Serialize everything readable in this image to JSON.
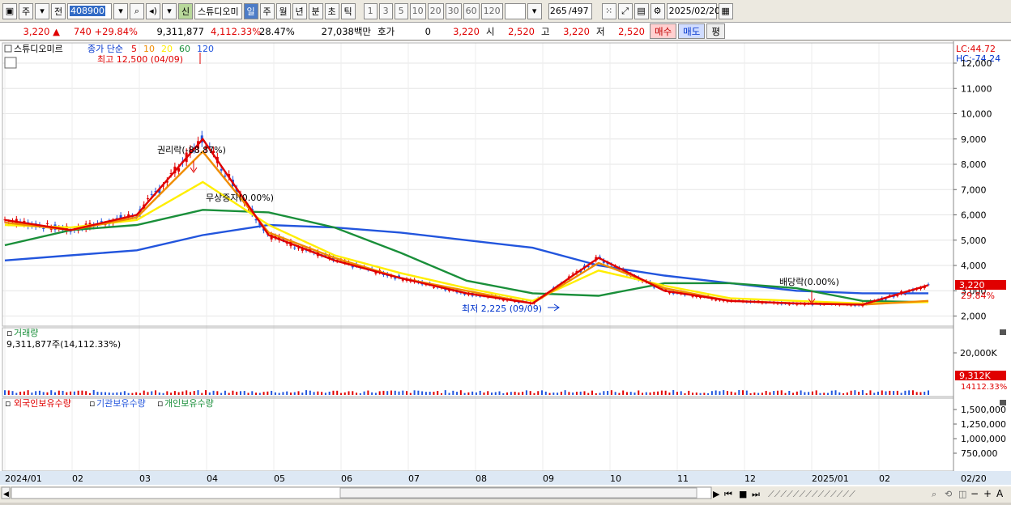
{
  "toolbar": {
    "market": "주",
    "prefix": "전",
    "code": "408900",
    "sin": "신",
    "stock_name": "스튜디오미",
    "periods": [
      "일",
      "주",
      "월",
      "년",
      "분",
      "초",
      "틱"
    ],
    "selected_period": "일",
    "intervals": [
      "1",
      "3",
      "5",
      "10",
      "20",
      "30",
      "60",
      "120"
    ],
    "count": "265",
    "total": "/497",
    "date": "2025/02/20"
  },
  "quote": {
    "price": "3,220",
    "change": "740",
    "change_pct": "+29.84%",
    "volume": "9,311,877",
    "volume_pct": "4,112.33%",
    "turnover": "28.47%",
    "amount": "27,038백만",
    "hoga_label": "호가",
    "hoga_value": "0",
    "hoga_price": "3,220",
    "open_label": "시",
    "open": "2,520",
    "high_label": "고",
    "high": "3,220",
    "low_label": "저",
    "low": "2,520",
    "buy": "매수",
    "sell": "매도",
    "eval": "평"
  },
  "price_panel": {
    "stock_label": "스튜디오미르",
    "ma_title": "종가 단순",
    "ma_periods": [
      "5",
      "10",
      "20",
      "60",
      "120"
    ],
    "ma_colors": [
      "#e00000",
      "#f08c00",
      "#ffee00",
      "#1a8f3a",
      "#2255dd"
    ],
    "lc": "LC:44.72",
    "hc": "HC:-74.24",
    "y_ticks": [
      "12,000",
      "11,000",
      "10,000",
      "9,000",
      "8,000",
      "7,000",
      "6,000",
      "5,000",
      "4,000",
      "3,000",
      "2,000"
    ],
    "max_label": "최고 12,500 (04/09)",
    "min_label": "최저 2,225 (09/09)",
    "rights_label": "권리락(-88.87%)",
    "bonus_label": "무상증자(0.00%)",
    "dividend_label": "배당락(0.00%)",
    "current_price": "3,220",
    "current_pct": "29.84%"
  },
  "volume_panel": {
    "title": "거래량",
    "value_text": "9,311,877주(14,112.33%)",
    "y_tick": "20,000K",
    "current": "9,312K",
    "current_pct": "14112.33%"
  },
  "holding_panel": {
    "legend": [
      "외국인보유수량",
      "기관보유수량",
      "개인보유수량"
    ],
    "y_ticks": [
      "1,500,000",
      "1,250,000",
      "1,000,000",
      "750,000"
    ]
  },
  "x_axis": {
    "labels": [
      "2024/01",
      "02",
      "03",
      "04",
      "05",
      "06",
      "07",
      "08",
      "09",
      "10",
      "11",
      "12",
      "2025/01",
      "02",
      "02/20"
    ]
  },
  "chart_data": {
    "type": "line",
    "x": [
      "2024/01",
      "2024/02",
      "2024/03",
      "2024/04",
      "2024/05",
      "2024/06",
      "2024/07",
      "2024/08",
      "2024/09",
      "2024/10",
      "2024/11",
      "2024/12",
      "2025/01",
      "2025/02",
      "2025/02/20"
    ],
    "series": [
      {
        "name": "5",
        "values": [
          5800,
          5400,
          6000,
          9000,
          5200,
          4200,
          3500,
          2900,
          2500,
          4300,
          3000,
          2600,
          2500,
          2450,
          3220
        ]
      },
      {
        "name": "10",
        "values": [
          5700,
          5400,
          5900,
          8500,
          5300,
          4300,
          3500,
          3000,
          2500,
          4100,
          3100,
          2600,
          2500,
          2450,
          2600
        ]
      },
      {
        "name": "20",
        "values": [
          5600,
          5500,
          5800,
          7300,
          5600,
          4400,
          3700,
          3100,
          2600,
          3800,
          3200,
          2700,
          2600,
          2500,
          2550
        ]
      },
      {
        "name": "60",
        "values": [
          4800,
          5400,
          5600,
          6200,
          6100,
          5500,
          4500,
          3400,
          2900,
          2800,
          3300,
          3300,
          3100,
          2600,
          2550
        ]
      },
      {
        "name": "120",
        "values": [
          4200,
          4400,
          4600,
          5200,
          5600,
          5500,
          5300,
          5000,
          4700,
          4000,
          3600,
          3300,
          3000,
          2900,
          2900
        ]
      }
    ],
    "ylim": [
      1600,
      12800
    ]
  }
}
